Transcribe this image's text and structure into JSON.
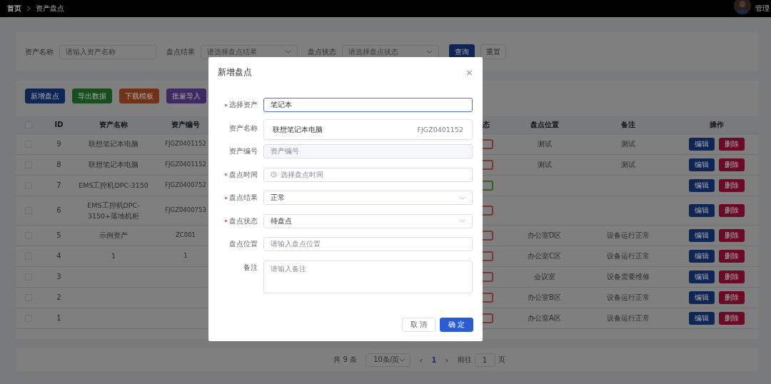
{
  "breadcrumb": [
    "首页",
    "资产盘点"
  ],
  "user": {
    "name": "管理"
  },
  "search": {
    "fields": [
      {
        "label": "资产名称",
        "placeholder": "请输入资产名称",
        "kind": "input"
      },
      {
        "label": "盘点结果",
        "placeholder": "请选择盘点结果",
        "kind": "select"
      },
      {
        "label": "盘点状态",
        "placeholder": "请选择盘点状态",
        "kind": "select"
      }
    ],
    "buttons": [
      {
        "label": "查询",
        "kind": "primary"
      },
      {
        "label": "重置",
        "kind": "plain"
      }
    ]
  },
  "actions": [
    {
      "label": "新增盘点",
      "kind": "add"
    },
    {
      "label": "导出数据",
      "kind": "export"
    },
    {
      "label": "下载模板",
      "kind": "download"
    },
    {
      "label": "批量导入",
      "kind": "import"
    }
  ],
  "table": {
    "all_checked": false,
    "columns": [
      "ID",
      "资产名称",
      "资产编号",
      "态",
      "盘点位置",
      "备注",
      "操作"
    ],
    "rows": [
      {
        "id": "9",
        "name": "联想笔记本电脑",
        "code": "FJGZ0401152",
        "color": "#7b3636",
        "location": "测试",
        "note": "测试",
        "checked": false,
        "actions": [
          "编辑",
          "删除"
        ]
      },
      {
        "id": "8",
        "name": "联想笔记本电脑",
        "code": "FJGZ0401152",
        "color": "#7b3636",
        "location": "测试",
        "note": "测试",
        "checked": false,
        "actions": [
          "编辑",
          "删除"
        ]
      },
      {
        "id": "7",
        "name": "EMS工控机DPC-3150",
        "code": "FJGZ0400752",
        "color": "#346120",
        "checked": false,
        "actions": [
          "编辑",
          "删除"
        ]
      },
      {
        "id": "6",
        "name": "EMS工控机DPC-3150+落地机柜",
        "code": "FJGZ0400753",
        "color": "#7b3636",
        "checked": false,
        "actions": [
          "编辑",
          "删除"
        ]
      },
      {
        "id": "5",
        "name": "示例资产",
        "code": "ZC001",
        "color": "#7b3636",
        "location": "办公室D区",
        "note": "设备运行正常",
        "checked": false,
        "actions": [
          "编辑",
          "删除"
        ]
      },
      {
        "id": "4",
        "name": "1",
        "code": "1",
        "color": "#7b3636",
        "location": "办公室C区",
        "note": "设备运行正常",
        "checked": false,
        "actions": [
          "编辑",
          "删除"
        ]
      },
      {
        "id": "3",
        "color": "#7b3636",
        "location": "会议室",
        "note": "设备需要维修",
        "checked": false,
        "actions": [
          "编辑",
          "删除"
        ]
      },
      {
        "id": "2",
        "color": "#7b3636",
        "location": "办公室B区",
        "note": "设备运行正常",
        "checked": false,
        "actions": [
          "编辑",
          "删除"
        ]
      },
      {
        "id": "1",
        "color": "#7b3636",
        "location": "办公室A区",
        "note": "设备运行正常",
        "checked": false,
        "actions": [
          "编辑",
          "删除"
        ]
      }
    ]
  },
  "pagination": {
    "total": "共 9 条",
    "page_size": "10条/页",
    "prev": "‹",
    "page": "1",
    "next": "›",
    "goto_label": "前往",
    "goto_value": "1",
    "goto_suffix": "页"
  },
  "dialog": {
    "title": "新增盘点",
    "close": "×",
    "fields": [
      {
        "label": "选择资产",
        "required": true,
        "kind": "input",
        "value": "笔记本",
        "focused": true
      },
      {
        "label": "资产名称",
        "required": false,
        "kind": "hidden"
      },
      {
        "label": "资产编号",
        "required": false,
        "kind": "disabled",
        "placeholder": "资产编号"
      },
      {
        "label": "盘点时间",
        "required": true,
        "kind": "time",
        "placeholder": "选择盘点时间"
      },
      {
        "label": "盘点结果",
        "required": true,
        "kind": "select",
        "value": "正常"
      },
      {
        "label": "盘点状态",
        "required": true,
        "kind": "select",
        "value": "待盘点"
      },
      {
        "label": "盘点位置",
        "required": false,
        "kind": "input",
        "placeholder": "请输入盘点位置"
      },
      {
        "label": "备注",
        "required": false,
        "kind": "textarea",
        "placeholder": "请输入备注"
      }
    ],
    "suggestion": {
      "name": "联想笔记本电脑",
      "code": "FJGZ0401152"
    },
    "buttons": [
      {
        "label": "取 消",
        "kind": "plain"
      },
      {
        "label": "确 定",
        "kind": "primary"
      }
    ]
  }
}
